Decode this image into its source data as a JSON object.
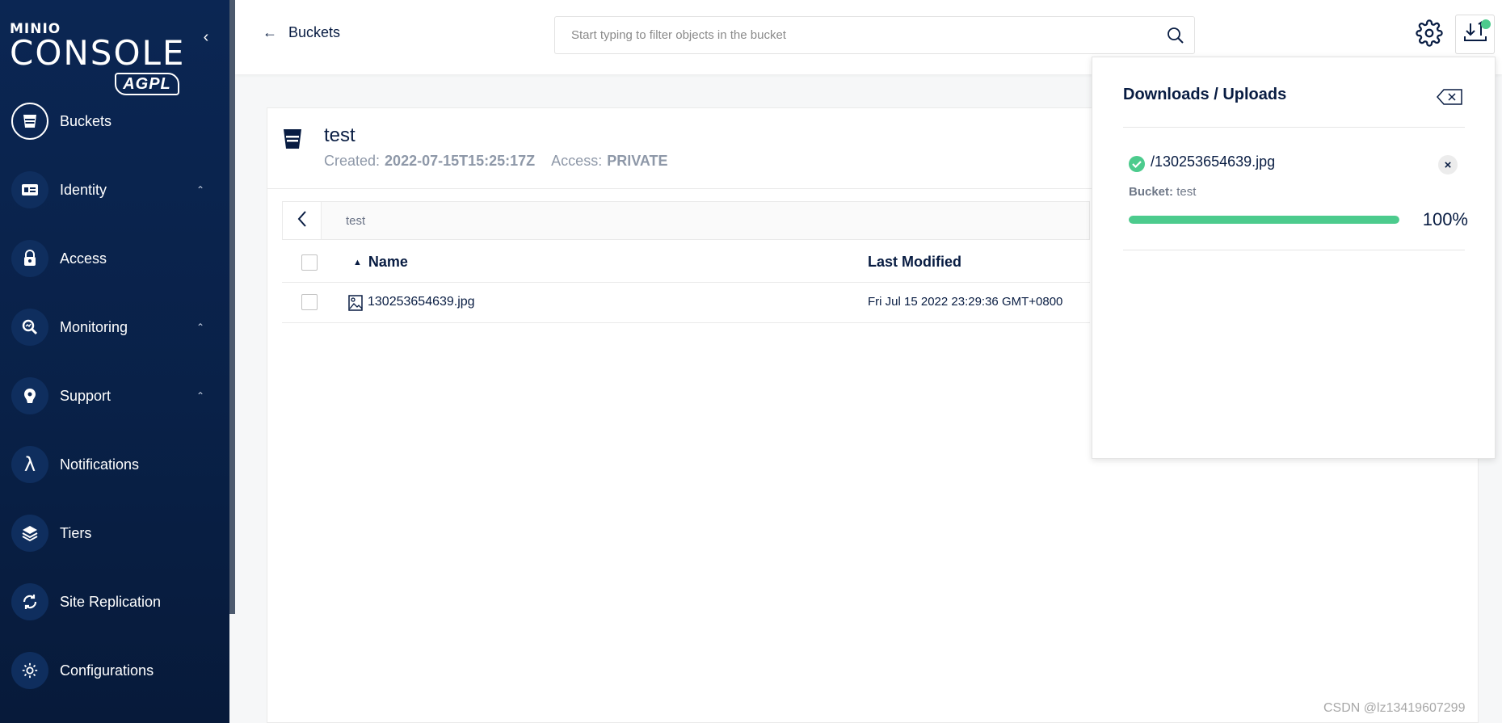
{
  "sidebar": {
    "logo": {
      "brand": "MINIO",
      "product": "CONSOLE",
      "license": "AGPL"
    },
    "items": [
      {
        "label": "Buckets",
        "icon": "bucket-icon"
      },
      {
        "label": "Identity",
        "icon": "id-card-icon",
        "expandable": true
      },
      {
        "label": "Access",
        "icon": "lock-icon"
      },
      {
        "label": "Monitoring",
        "icon": "monitor-search-icon",
        "expandable": true
      },
      {
        "label": "Support",
        "icon": "support-icon",
        "expandable": true
      },
      {
        "label": "Notifications",
        "icon": "lambda-icon"
      },
      {
        "label": "Tiers",
        "icon": "layers-icon"
      },
      {
        "label": "Site Replication",
        "icon": "sync-icon"
      },
      {
        "label": "Configurations",
        "icon": "gear-icon"
      }
    ]
  },
  "topbar": {
    "back_label": "Buckets",
    "search_placeholder": "Start typing to filter objects in the bucket"
  },
  "bucket": {
    "name": "test",
    "created_label": "Created:",
    "created_value": "2022-07-15T15:25:17Z",
    "access_label": "Access:",
    "access_value": "PRIVATE"
  },
  "breadcrumb": "test",
  "table": {
    "columns": {
      "name": "Name",
      "modified": "Last Modified"
    },
    "rows": [
      {
        "name": "130253654639.jpg",
        "modified": "Fri Jul 15 2022 23:29:36 GMT+0800"
      }
    ]
  },
  "downloads": {
    "title": "Downloads / Uploads",
    "items": [
      {
        "name": "/130253654639.jpg",
        "bucket_label": "Bucket:",
        "bucket": "test",
        "progress": 100,
        "progress_text": "100%"
      }
    ]
  },
  "watermark": "CSDN @lz13419607299",
  "colors": {
    "sidebar": "#0b2653",
    "accent_green": "#4ccb8d",
    "text_dark": "#081c42"
  }
}
